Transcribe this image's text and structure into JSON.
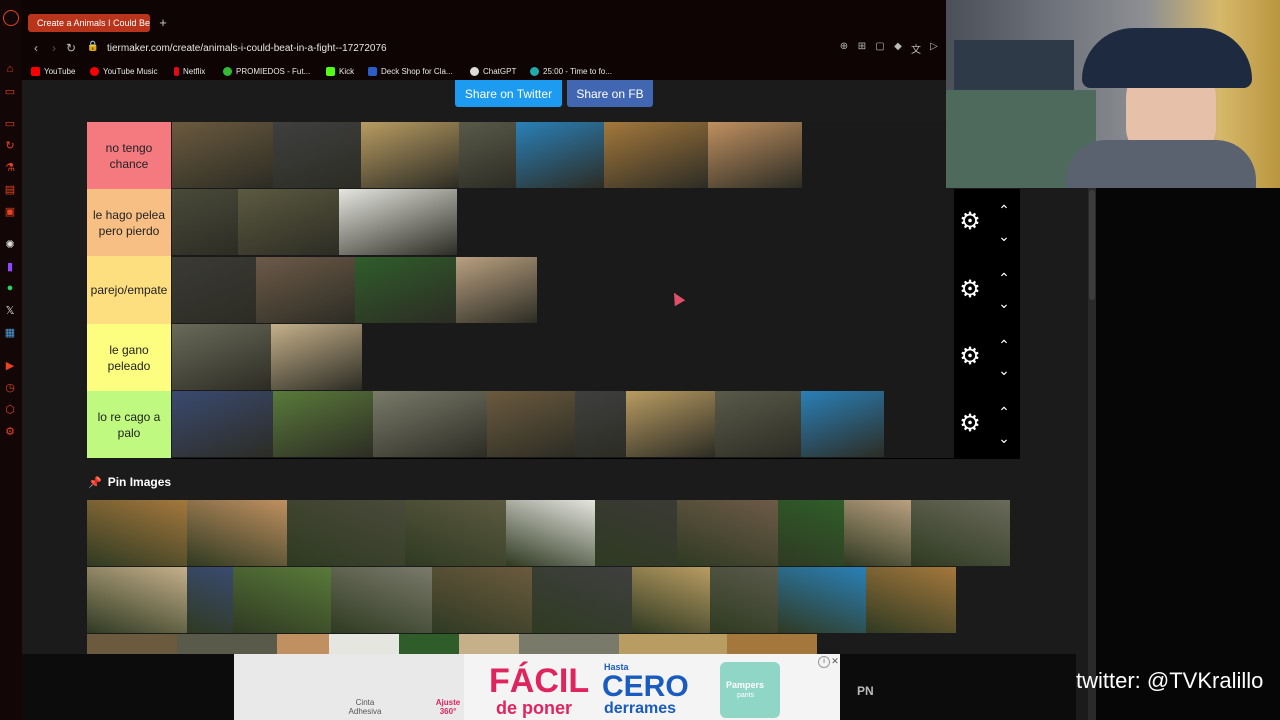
{
  "browser": {
    "tab_title": "Create a Animals I Could Be",
    "url": "tiermaker.com/create/animals-i-could-beat-in-a-fight--17272076",
    "bookmarks": [
      "YouTube",
      "YouTube Music",
      "Netflix",
      "PROMIEDOS - Fut...",
      "Kick",
      "Deck Shop for Cla...",
      "ChatGPT",
      "25:00 - Time to fo..."
    ],
    "colors": {
      "accent": "#e8441f",
      "tab": "#b8341a"
    }
  },
  "share": {
    "twitter": "Share on Twitter",
    "fb": "Share on FB"
  },
  "tiers": [
    {
      "label": "no tengo chance",
      "color": "#f47a7f",
      "items": [
        "bison",
        "black bull",
        "cheetah",
        "cassowary",
        "barracuda",
        "cobra",
        "caracal"
      ]
    },
    {
      "label": "le hago pelea pero pierdo",
      "color": "#f8bf84",
      "items": [
        "baboon",
        "chimpanzee",
        "cow"
      ]
    },
    {
      "label": "parejo/empate",
      "color": "#fedf7f",
      "items": [
        "wild boar",
        "deer",
        "camel",
        "coyote"
      ]
    },
    {
      "label": "le gano peleado",
      "color": "#fdfd7f",
      "items": [
        "crocodile",
        "capybara"
      ]
    },
    {
      "label": "lo re cago a palo",
      "color": "#bff97f",
      "items": [
        "badger",
        "chicken",
        "chipmunk",
        "beaver",
        "alpaca",
        "eagle",
        "frog",
        "cat"
      ]
    }
  ],
  "pin_label": "Pin Images",
  "pool_images": [
    "aardwolf",
    "aardvark",
    "black bear",
    "alligator",
    "dingo",
    "antelope",
    "dolphin",
    "goat",
    "donkey",
    "snake",
    "elephant",
    "penguin",
    "emu",
    "ferret",
    "flamingo",
    "fossa",
    "fox",
    "gazelle",
    "german shepherd",
    "panda"
  ],
  "ad": {
    "line1a": "FÁCIL",
    "line1b": "de poner",
    "line2a": "CERO",
    "line2b": "derrames",
    "hasta": "Hasta",
    "brand": "Pampers",
    "sub1": "Cinta Adhesiva",
    "sub2": "Ajuste 360°",
    "pants": "pants",
    "side": "PN"
  },
  "overlay": {
    "twitter": "twitter: @TVKralillo"
  }
}
